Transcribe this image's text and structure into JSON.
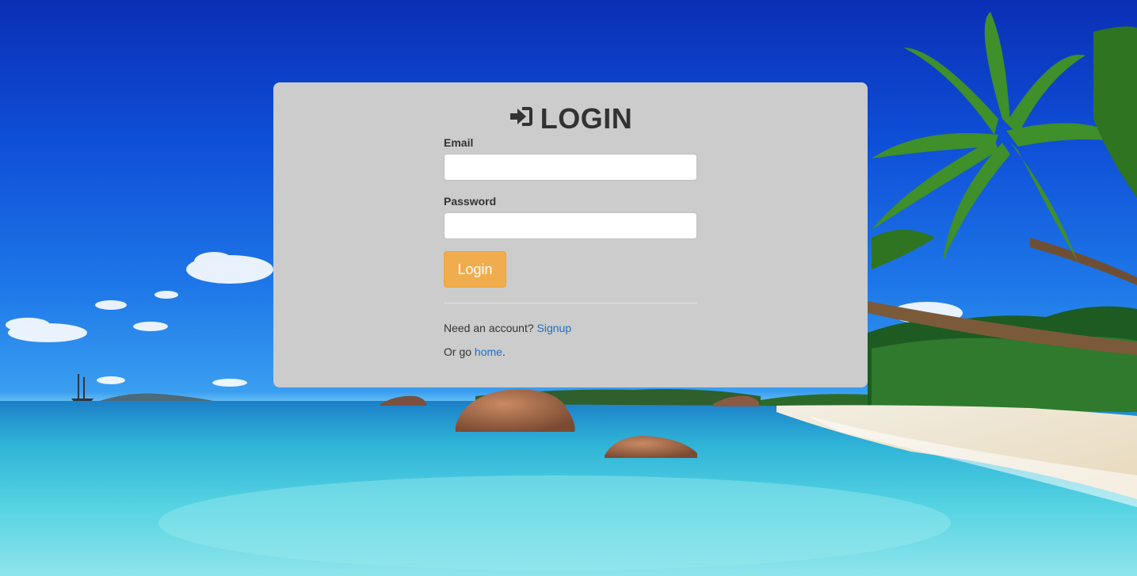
{
  "login": {
    "title": "LOGIN",
    "icon": "sign-in-icon",
    "email_label": "Email",
    "email_value": "",
    "password_label": "Password",
    "password_value": "",
    "submit_label": "Login",
    "signup_prompt": "Need an account?",
    "signup_link": "Signup",
    "home_prefix": "Or go",
    "home_link": "home",
    "home_suffix": "."
  },
  "colors": {
    "card_background": "#cccccc",
    "button": "#f0ad4e",
    "link": "#1f6fc4",
    "text": "#333333"
  }
}
